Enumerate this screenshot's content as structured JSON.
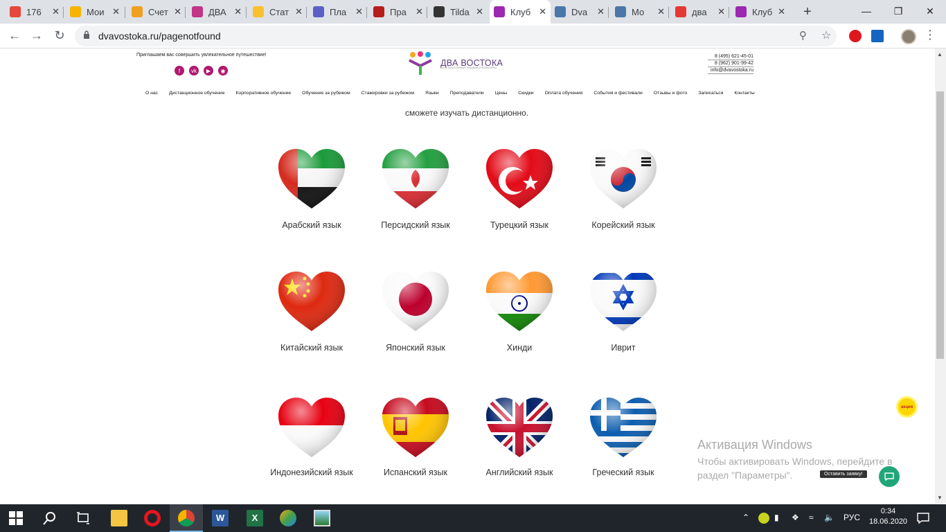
{
  "browser": {
    "tabs": [
      {
        "title": "176",
        "favicon_color": "#e8453c"
      },
      {
        "title": "Мои",
        "favicon_color": "#f6b400"
      },
      {
        "title": "Счет",
        "favicon_color": "#f0a020"
      },
      {
        "title": "ДВА",
        "favicon_color": "#c13584"
      },
      {
        "title": "Стат",
        "favicon_color": "#fbc02d"
      },
      {
        "title": "Пла",
        "favicon_color": "#5b5fc7"
      },
      {
        "title": "Пра",
        "favicon_color": "#b71c1c"
      },
      {
        "title": "Tilda",
        "favicon_color": "#333333"
      },
      {
        "title": "Клуб",
        "favicon_color": "#9c27b0"
      },
      {
        "title": "Dva",
        "favicon_color": "#4a76a8"
      },
      {
        "title": "Мо",
        "favicon_color": "#4a76a8"
      },
      {
        "title": "два",
        "favicon_color": "#e53935"
      },
      {
        "title": "Клуб",
        "favicon_color": "#9c27b0"
      }
    ],
    "url": "dvavostoka.ru/pagenotfound"
  },
  "header": {
    "invite": "Приглашаем вас совершить увлекательное путешествие!",
    "socials": [
      "f",
      "vk",
      "yt",
      "ig"
    ],
    "logo_name": "ДВА ВОСТОКА",
    "logo_sub": "КЛУБ ВОСТОЧНЫХ ЯЗЫКОВ И КУЛЬТУРЫ",
    "phone1": "8 (495) 621-45-01",
    "phone2": "8 (962) 901-99-42",
    "email": "info@dvavostoka.ru"
  },
  "menu": [
    "О нас",
    "Дистанционное обучение",
    "Корпоративное обучение",
    "Обучение за рубежом",
    "Стажировки за рубежом",
    "Языки",
    "Преподаватели",
    "Цены",
    "Скидки",
    "Оплата обучения",
    "События и фестивали",
    "Отзывы и фото",
    "Записаться",
    "Контакты"
  ],
  "partial_text": "сможете изучать дистанционно.",
  "languages": [
    {
      "label": "Арабский язык",
      "flag": "uae"
    },
    {
      "label": "Персидский язык",
      "flag": "iran"
    },
    {
      "label": "Турецкий язык",
      "flag": "turkey"
    },
    {
      "label": "Корейский язык",
      "flag": "korea"
    },
    {
      "label": "Китайский язык",
      "flag": "china"
    },
    {
      "label": "Японский язык",
      "flag": "japan"
    },
    {
      "label": "Хинди",
      "flag": "india"
    },
    {
      "label": "Иврит",
      "flag": "israel"
    },
    {
      "label": "Индонезийский язык",
      "flag": "indonesia"
    },
    {
      "label": "Испанский язык",
      "flag": "spain"
    },
    {
      "label": "Английский язык",
      "flag": "uk"
    },
    {
      "label": "Греческий язык",
      "flag": "greece"
    }
  ],
  "promo_badge": "акция",
  "request_tooltip": "Оставить заявку!",
  "watermark": {
    "title": "Активация Windows",
    "line1": "Чтобы активировать Windows, перейдите в",
    "line2": "раздел \"Параметры\"."
  },
  "taskbar": {
    "lang": "РУС",
    "time": "0:34",
    "date": "18.06.2020"
  }
}
